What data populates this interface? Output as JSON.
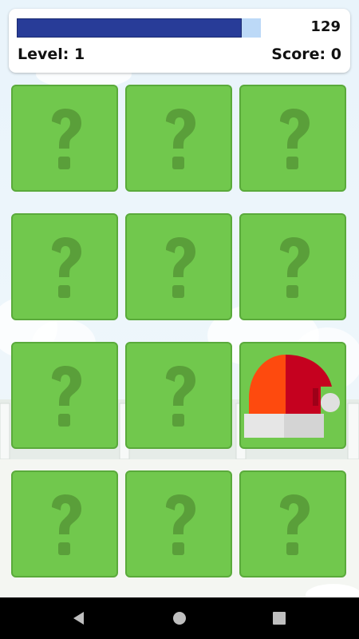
{
  "hud": {
    "timer": "129",
    "level_label": "Level: 1",
    "score_label": "Score: 0",
    "time_fraction": 0.92
  },
  "board": {
    "rows": 4,
    "cols": 3,
    "tiles": [
      {
        "state": "hidden"
      },
      {
        "state": "hidden"
      },
      {
        "state": "hidden"
      },
      {
        "state": "hidden"
      },
      {
        "state": "hidden"
      },
      {
        "state": "hidden"
      },
      {
        "state": "hidden"
      },
      {
        "state": "hidden"
      },
      {
        "state": "revealed",
        "icon": "santa-hat-icon"
      },
      {
        "state": "hidden"
      },
      {
        "state": "hidden"
      },
      {
        "state": "hidden"
      }
    ]
  },
  "colors": {
    "tile": "#71c84d",
    "tile_border": "#5aaa3b",
    "question_mark": "#5a9f3a",
    "bar_fill": "#283c98",
    "bar_track": "#bcd9f7"
  },
  "navbar": {
    "buttons": [
      "back-icon",
      "home-icon",
      "recents-icon"
    ]
  }
}
